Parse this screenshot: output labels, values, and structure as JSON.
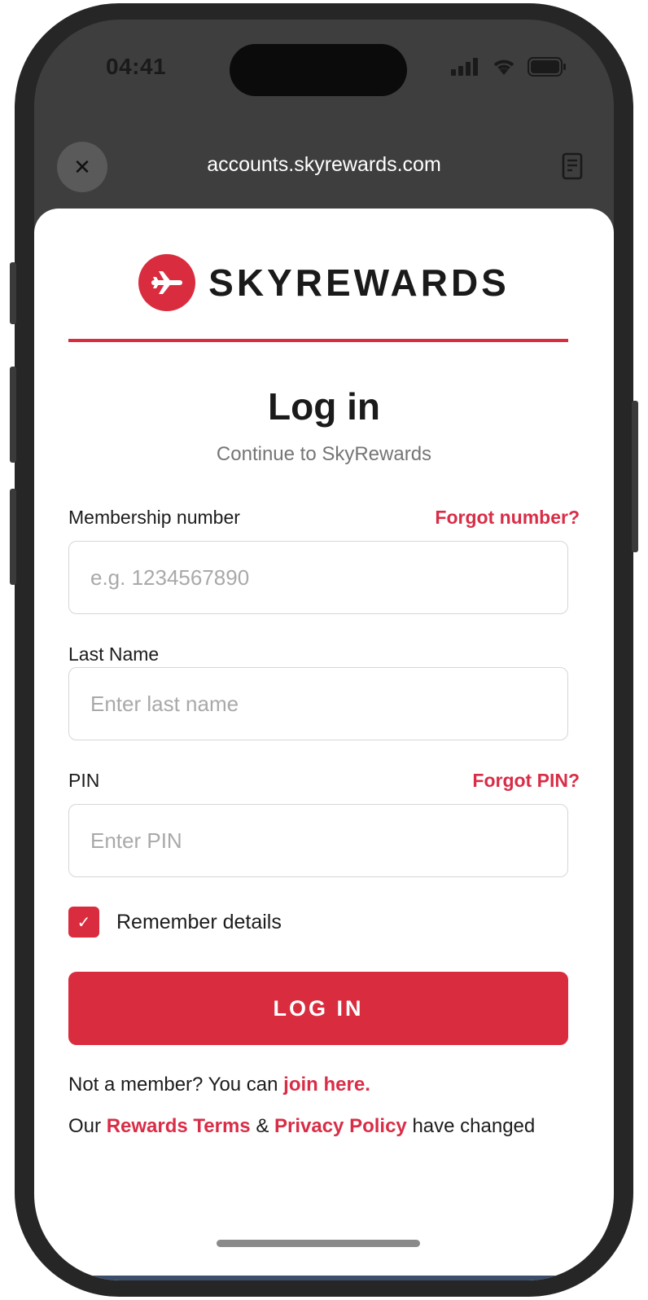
{
  "status_bar": {
    "time": "04:41"
  },
  "browser": {
    "url": "accounts.skyrewards.com"
  },
  "brand": {
    "name": "SKYREWARDS"
  },
  "header": {
    "title": "Log in",
    "subtitle": "Continue to SkyRewards"
  },
  "form": {
    "membership": {
      "label": "Membership number",
      "link": "Forgot number?",
      "placeholder": "e.g. 1234567890",
      "value": ""
    },
    "last_name": {
      "label": "Last Name",
      "placeholder": "Enter last name",
      "value": ""
    },
    "pin": {
      "label": "PIN",
      "link": "Forgot PIN?",
      "placeholder": "Enter PIN",
      "value": ""
    },
    "remember": {
      "label": "Remember details",
      "checked": true
    }
  },
  "login_button": "LOG IN",
  "footer": {
    "join_prefix": "Not a member? You can ",
    "join_link": "join here.",
    "terms_prefix": "Our ",
    "terms_link": "Rewards Terms",
    "amp": " & ",
    "privacy_link": "Privacy Policy",
    "terms_suffix": " have changed"
  },
  "colors": {
    "brand_red": "#d92d3f",
    "link_red": "#d92d47"
  },
  "icons": {
    "close": "close-icon",
    "reader": "reader-icon",
    "logo": "airplane-icon"
  }
}
